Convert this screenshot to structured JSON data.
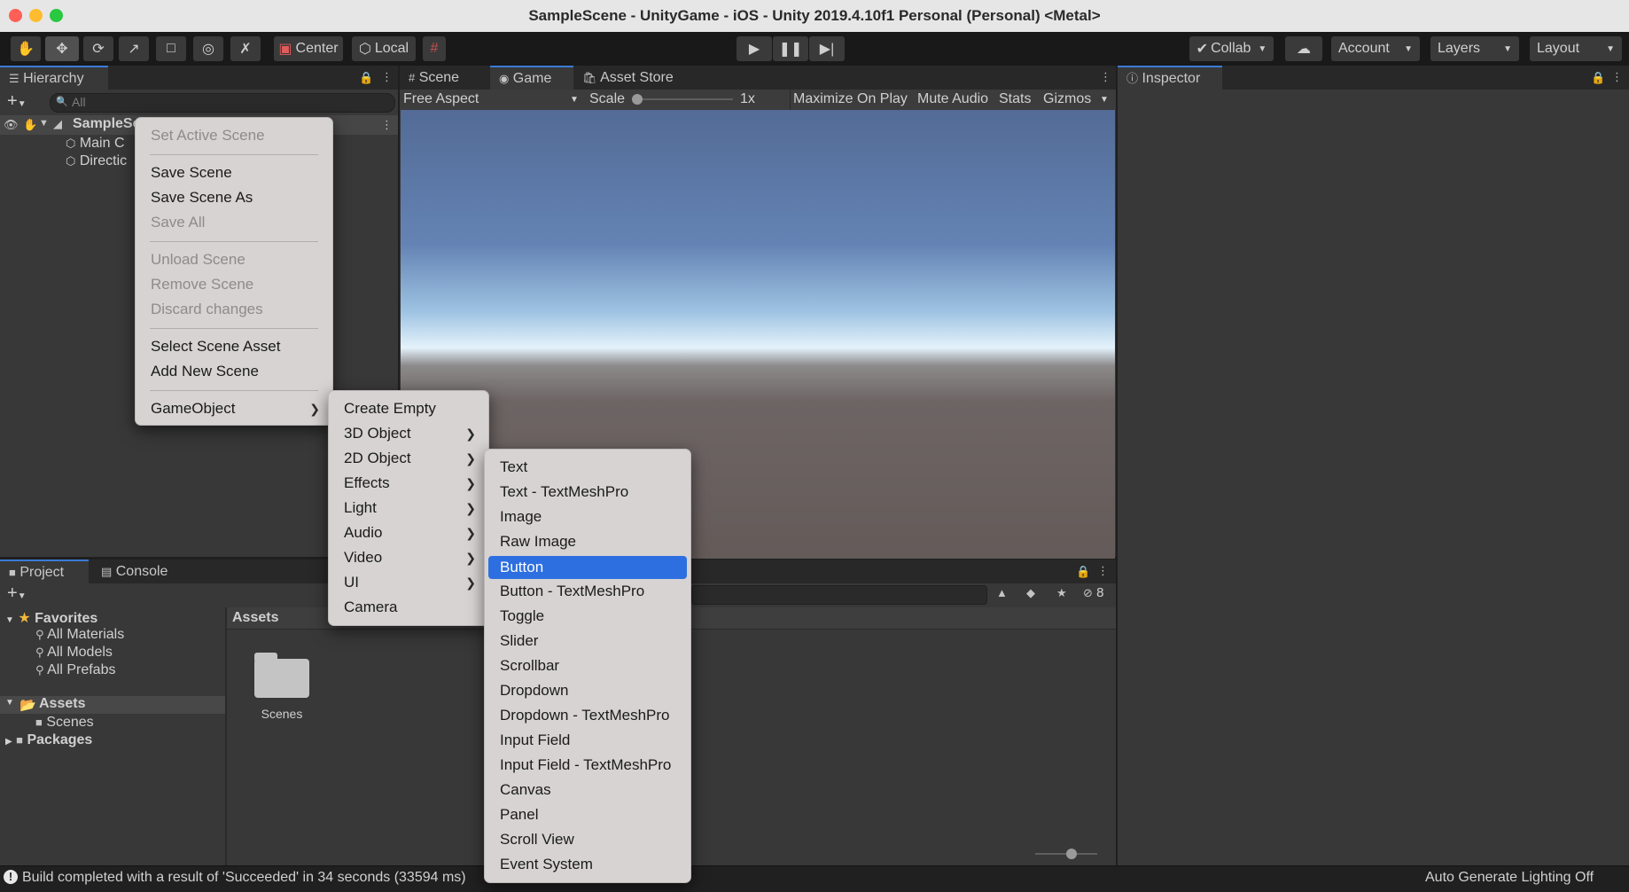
{
  "window": {
    "title": "SampleScene - UnityGame - iOS - Unity 2019.4.10f1 Personal (Personal) <Metal>"
  },
  "toolbar": {
    "tools": [
      "hand-tool-icon",
      "move-tool-icon",
      "rotate-tool-icon",
      "scale-tool-icon",
      "rect-tool-icon",
      "transform-tool-icon",
      "custom-tool-icon"
    ],
    "pivot_label": "Center",
    "space_label": "Local",
    "collab_label": "Collab",
    "account_label": "Account",
    "layers_label": "Layers",
    "layout_label": "Layout"
  },
  "hierarchy": {
    "tab_label": "Hierarchy",
    "search_placeholder": "All",
    "scene_name": "SampleSc",
    "items": [
      "Main C",
      "Directic"
    ]
  },
  "center": {
    "tabs": [
      {
        "label": "Scene"
      },
      {
        "label": "Game"
      },
      {
        "label": "Asset Store"
      }
    ],
    "aspect_label": "Free Aspect",
    "scale_label": "Scale",
    "scale_value": "1x",
    "maximize_label": "Maximize On Play",
    "mute_label": "Mute Audio",
    "stats_label": "Stats",
    "gizmos_label": "Gizmos"
  },
  "inspector": {
    "tab_label": "Inspector"
  },
  "project": {
    "tabs": [
      {
        "label": "Project"
      },
      {
        "label": "Console"
      }
    ],
    "favorites_label": "Favorites",
    "favorites": [
      "All Materials",
      "All Models",
      "All Prefabs"
    ],
    "assets_label": "Assets",
    "assets_children": [
      "Scenes"
    ],
    "packages_label": "Packages",
    "breadcrumb": "Assets",
    "folder_label": "Scenes",
    "hidden_count": "8"
  },
  "context_menu": {
    "items": [
      {
        "label": "Set Active Scene",
        "disabled": true
      },
      {
        "label": "Save Scene",
        "disabled": false
      },
      {
        "label": "Save Scene As",
        "disabled": false
      },
      {
        "label": "Save All",
        "disabled": true
      },
      {
        "label": "Unload Scene",
        "disabled": true
      },
      {
        "label": "Remove Scene",
        "disabled": true
      },
      {
        "label": "Discard changes",
        "disabled": true
      },
      {
        "label": "Select Scene Asset",
        "disabled": false
      },
      {
        "label": "Add New Scene",
        "disabled": false
      },
      {
        "label": "GameObject",
        "disabled": false
      }
    ]
  },
  "gameobject_menu": {
    "items": [
      "Create Empty",
      "3D Object",
      "2D Object",
      "Effects",
      "Light",
      "Audio",
      "Video",
      "UI",
      "Camera"
    ]
  },
  "ui_menu": {
    "items": [
      "Text",
      "Text - TextMeshPro",
      "Image",
      "Raw Image",
      "Button",
      "Button - TextMeshPro",
      "Toggle",
      "Slider",
      "Scrollbar",
      "Dropdown",
      "Dropdown - TextMeshPro",
      "Input Field",
      "Input Field - TextMeshPro",
      "Canvas",
      "Panel",
      "Scroll View",
      "Event System"
    ],
    "highlighted": "Button"
  },
  "status": {
    "message": "Build completed with a result of 'Succeeded' in 34 seconds (33594 ms)",
    "lighting": "Auto Generate Lighting Off"
  }
}
